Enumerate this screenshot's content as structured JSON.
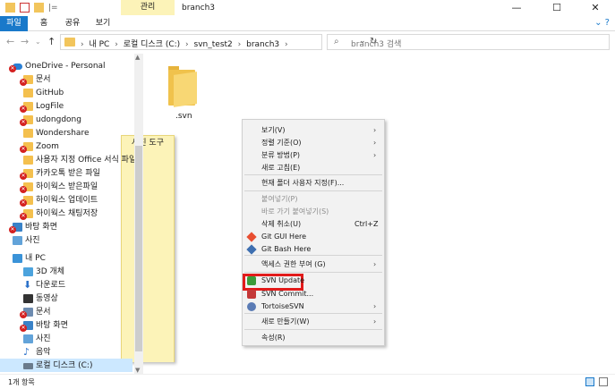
{
  "titlebar": {
    "contextual_tab": "관리",
    "title": "branch3",
    "qat_separator": "|="
  },
  "ribbon": {
    "tabs": [
      "파일",
      "홈",
      "공유",
      "보기",
      "사진 도구"
    ]
  },
  "address": {
    "crumbs": [
      "내 PC",
      "로컬 디스크 (C:)",
      "svn_test2",
      "branch3"
    ],
    "search_placeholder": "branch3 검색"
  },
  "nav": {
    "items": [
      {
        "label": "OneDrive - Personal",
        "icon": "cloud-icon",
        "badge": true
      },
      {
        "label": "문서",
        "icon": "folder-icon",
        "badge": true
      },
      {
        "label": "GitHub",
        "icon": "folder-icon",
        "badge": false
      },
      {
        "label": "LogFile",
        "icon": "folder-icon",
        "badge": true
      },
      {
        "label": "udongdong",
        "icon": "folder-icon",
        "badge": true
      },
      {
        "label": "Wondershare",
        "icon": "folder-icon",
        "badge": false
      },
      {
        "label": "Zoom",
        "icon": "folder-icon",
        "badge": true
      },
      {
        "label": "사용자 지정 Office 서식 파일",
        "icon": "folder-icon",
        "badge": false
      },
      {
        "label": "카카오톡 받은 파일",
        "icon": "folder-icon",
        "badge": true
      },
      {
        "label": "하이웍스 받은파일",
        "icon": "folder-icon",
        "badge": true
      },
      {
        "label": "하이웍스 업데이트",
        "icon": "folder-icon",
        "badge": true
      },
      {
        "label": "하이웍스 채팅저장",
        "icon": "folder-icon",
        "badge": true
      },
      {
        "label": "바탕 화면",
        "icon": "desktop-icon",
        "badge": true
      },
      {
        "label": "사진",
        "icon": "pictures-icon",
        "badge": false
      },
      {
        "label": "내 PC",
        "icon": "pc-icon",
        "badge": false
      },
      {
        "label": "3D 개체",
        "icon": "3d-objects-icon",
        "badge": false
      },
      {
        "label": "다운로드",
        "icon": "download-icon",
        "badge": false
      },
      {
        "label": "동영상",
        "icon": "video-icon",
        "badge": false
      },
      {
        "label": "문서",
        "icon": "document-icon",
        "badge": true
      },
      {
        "label": "바탕 화면",
        "icon": "desktop-icon",
        "badge": true
      },
      {
        "label": "사진",
        "icon": "pictures-icon",
        "badge": false
      },
      {
        "label": "음악",
        "icon": "music-icon",
        "badge": false
      },
      {
        "label": "로컬 디스크 (C:)",
        "icon": "drive-icon",
        "badge": false
      }
    ]
  },
  "content": {
    "items": [
      {
        "name": ".svn",
        "icon": "folder-icon"
      }
    ]
  },
  "context_menu": {
    "items": [
      {
        "label": "보기(V)",
        "submenu": true
      },
      {
        "label": "정렬 기준(O)",
        "submenu": true
      },
      {
        "label": "분류 방법(P)",
        "submenu": true
      },
      {
        "label": "새로 고침(E)"
      },
      {
        "label": "현재 폴더 사용자 지정(F)..."
      },
      {
        "label": "붙여넣기(P)",
        "disabled": true
      },
      {
        "label": "바로 가기 붙여넣기(S)",
        "disabled": true
      },
      {
        "label": "삭제 취소(U)",
        "shortcut": "Ctrl+Z"
      },
      {
        "label": "Git GUI Here",
        "icon": "git-gui-icon"
      },
      {
        "label": "Git Bash Here",
        "icon": "git-bash-icon"
      },
      {
        "label": "액세스 권한 부여 (G)",
        "submenu": true
      },
      {
        "label": "SVN Update",
        "icon": "svn-update-icon"
      },
      {
        "label": "SVN Commit...",
        "icon": "svn-commit-icon"
      },
      {
        "label": "TortoiseSVN",
        "icon": "tortoisesvn-icon",
        "submenu": true
      },
      {
        "label": "새로 만들기(W)",
        "submenu": true
      },
      {
        "label": "속성(R)"
      }
    ]
  },
  "status": {
    "item_count": "1개 항목"
  },
  "colors": {
    "accent": "#1979ca",
    "highlight_box": "#e21b1b",
    "contextual_tab": "#fcf3b8"
  }
}
